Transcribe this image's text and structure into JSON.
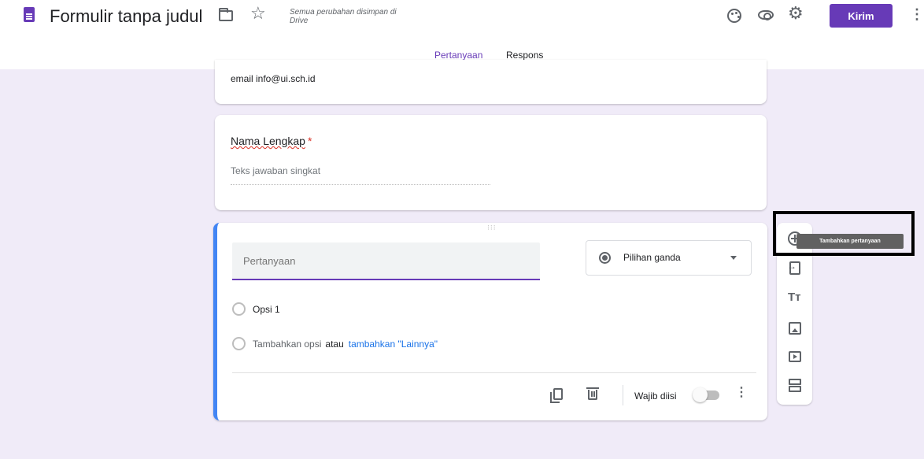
{
  "header": {
    "title": "Formulir tanpa judul",
    "save_status": "Semua perubahan disimpan di Drive",
    "send_label": "Kirim"
  },
  "tabs": [
    {
      "label": "Pertanyaan",
      "active": true
    },
    {
      "label": "Respons",
      "active": false
    }
  ],
  "description_card": {
    "text": "email info@ui.sch.id"
  },
  "name_question": {
    "title": "Nama Lengkap",
    "required_marker": "*",
    "answer_placeholder": "Teks jawaban singkat"
  },
  "active_question": {
    "question_placeholder": "Pertanyaan",
    "type": "Pilihan ganda",
    "options": [
      "Opsi 1"
    ],
    "add_option": "Tambahkan opsi",
    "or": "atau",
    "add_other": "tambahkan \"Lainnya\"",
    "required_label": "Wajib diisi",
    "required_on": false
  },
  "side_toolbar": {
    "tooltip": "Tambahkan pertanyaan",
    "icons": [
      "add-question-icon",
      "import-questions-icon",
      "add-title-icon",
      "add-image-icon",
      "add-video-icon",
      "add-section-icon"
    ]
  },
  "colors": {
    "accent": "#673ab7",
    "active_border": "#4285f4",
    "canvas": "#f0ebf8",
    "link": "#1a73e8"
  }
}
